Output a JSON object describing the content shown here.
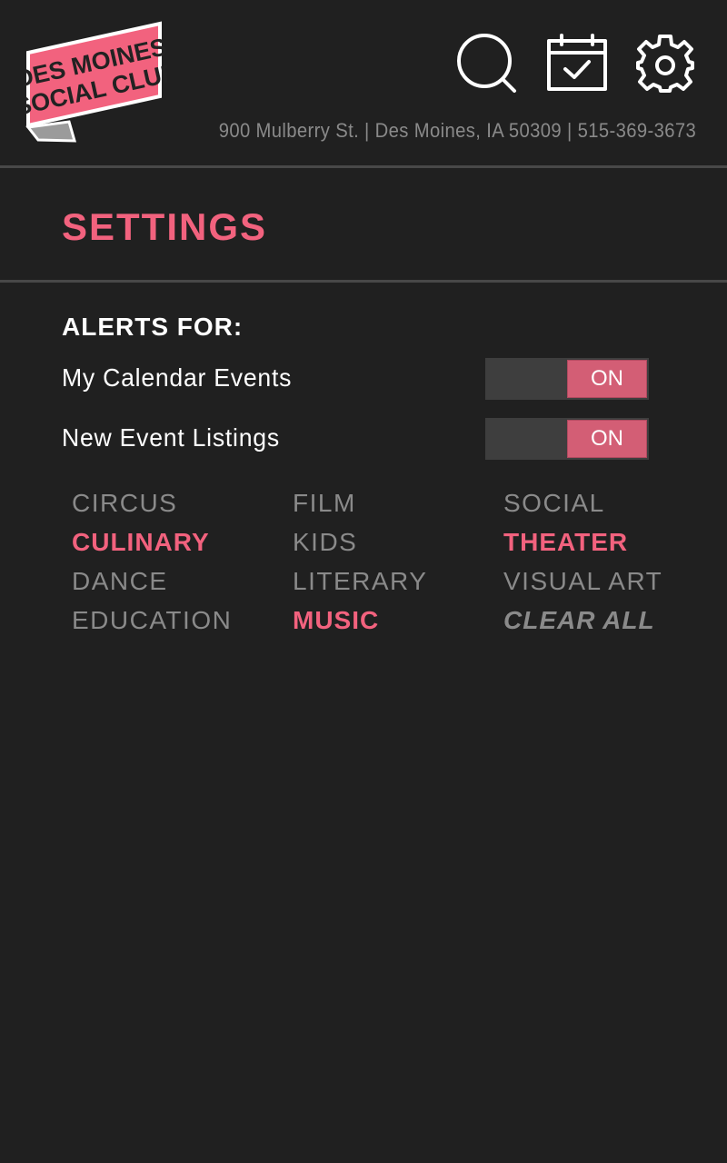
{
  "brand": {
    "logo_line1": "DES MOINES",
    "logo_line2": "SOCIAL CLUB",
    "address": "900 Mulberry St. | Des Moines, IA 50309 | 515-369-3673",
    "accent_color": "#f2627e"
  },
  "header": {
    "icons": [
      "search-icon",
      "calendar-check-icon",
      "gear-icon"
    ]
  },
  "page": {
    "title": "SETTINGS"
  },
  "alerts": {
    "heading": "ALERTS FOR:",
    "rows": [
      {
        "label": "My Calendar Events",
        "state": "ON"
      },
      {
        "label": "New Event Listings",
        "state": "ON"
      }
    ]
  },
  "categories": {
    "items": [
      {
        "label": "CIRCUS",
        "selected": false
      },
      {
        "label": "CULINARY",
        "selected": true
      },
      {
        "label": "DANCE",
        "selected": false
      },
      {
        "label": "EDUCATION",
        "selected": false
      },
      {
        "label": "FILM",
        "selected": false
      },
      {
        "label": "KIDS",
        "selected": false
      },
      {
        "label": "LITERARY",
        "selected": false
      },
      {
        "label": "MUSIC",
        "selected": true
      },
      {
        "label": "SOCIAL",
        "selected": false
      },
      {
        "label": "THEATER",
        "selected": true
      },
      {
        "label": "VISUAL ART",
        "selected": false
      }
    ],
    "clear_label": "CLEAR ALL"
  }
}
